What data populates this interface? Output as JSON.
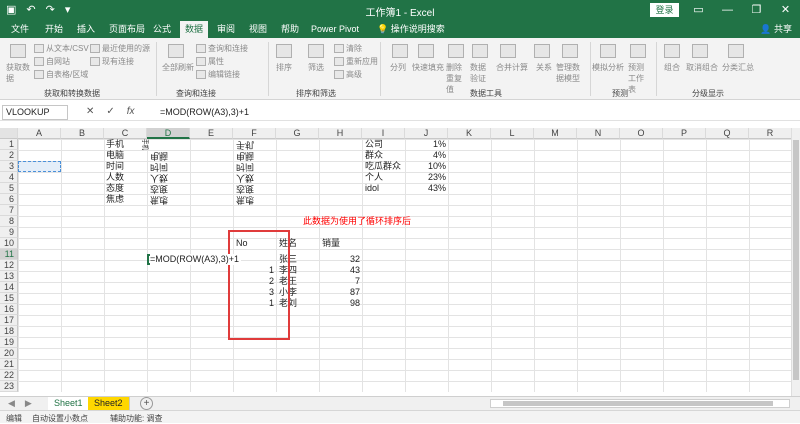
{
  "window": {
    "title": "工作簿1 - Excel",
    "login": "登录"
  },
  "tabs": [
    "文件",
    "开始",
    "插入",
    "页面布局",
    "公式",
    "数据",
    "审阅",
    "视图",
    "帮助",
    "Power Pivot"
  ],
  "tell_me": "操作说明搜索",
  "share": "共享",
  "ribbon": {
    "groups": [
      "获取和转换数据",
      "查询和连接",
      "排序和筛选",
      "数据工具",
      "预测",
      "分级显示"
    ],
    "get_data": "获取数据",
    "items": [
      "从文本/CSV",
      "自网站",
      "自表格/区域",
      "最近使用的源",
      "现有连接",
      "全部刷新",
      "查询和连接",
      "属性",
      "编辑链接",
      "排序",
      "筛选",
      "清除",
      "重新应用",
      "高级",
      "分列",
      "快速填充",
      "删除重复值",
      "数据验证",
      "合并计算",
      "关系",
      "管理数据模型",
      "模拟分析",
      "预测工作表",
      "组合",
      "取消组合",
      "分类汇总"
    ]
  },
  "formula_bar": {
    "name_box": "VLOOKUP",
    "cancel": "✕",
    "enter": "✓",
    "fx": "fx",
    "formula": "=MOD(ROW(A3),3)+1"
  },
  "columns": [
    "A",
    "B",
    "C",
    "D",
    "E",
    "F",
    "G",
    "H",
    "I",
    "J",
    "K",
    "L",
    "M",
    "N",
    "O",
    "P",
    "Q",
    "R"
  ],
  "rows": [
    "1",
    "2",
    "3",
    "4",
    "5",
    "6",
    "7",
    "8",
    "9",
    "10",
    "11",
    "12",
    "13",
    "14",
    "15",
    "16",
    "17",
    "18",
    "19",
    "20",
    "21",
    "22",
    "23"
  ],
  "cells": {
    "c_col": [
      "手机",
      "电脑",
      "时间",
      "人数",
      "态度",
      "焦虑"
    ],
    "i_col": [
      "公司",
      "群众",
      "吃瓜群众",
      "个人",
      "idol"
    ],
    "j_col": [
      "1%",
      "4%",
      "10%",
      "23%",
      "43%"
    ],
    "note": "此数据为使用了循环排序后",
    "hdr_no": "No",
    "hdr_name": "姓名",
    "hdr_sales": "销量",
    "edit_formula": "=MOD(ROW(A3),3)+1",
    "nums_f": [
      "1",
      "2",
      "3",
      "1"
    ],
    "names": [
      "张三",
      "李四",
      "老王",
      "小李",
      "老刘"
    ],
    "sales": [
      "32",
      "43",
      "7",
      "87",
      "98"
    ]
  },
  "sheets": [
    "Sheet1",
    "Sheet2"
  ],
  "status": {
    "mode": "编辑",
    "auto": "自动设置小数点",
    "access": "辅助功能: 调查"
  }
}
